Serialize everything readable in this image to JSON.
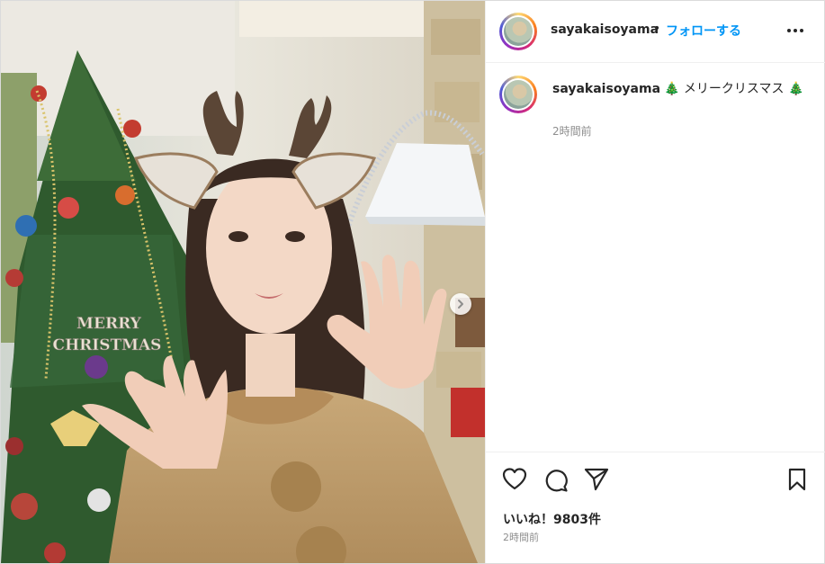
{
  "post": {
    "username": "sayakaisoyama",
    "separator": "•",
    "follow_label": "フォローする",
    "more_icon": "more-horizontal-icon",
    "caption_text": "🎄 メリークリスマス 🎄",
    "caption_time": "2時間前",
    "likes": "いいね！9803件",
    "post_time": "2時間前"
  },
  "media": {
    "sign_line1": "MERRY",
    "sign_line2": "CHRISTMAS"
  },
  "colors": {
    "accent": "#0095f6",
    "text": "#262626",
    "muted": "#8e8e8e"
  }
}
